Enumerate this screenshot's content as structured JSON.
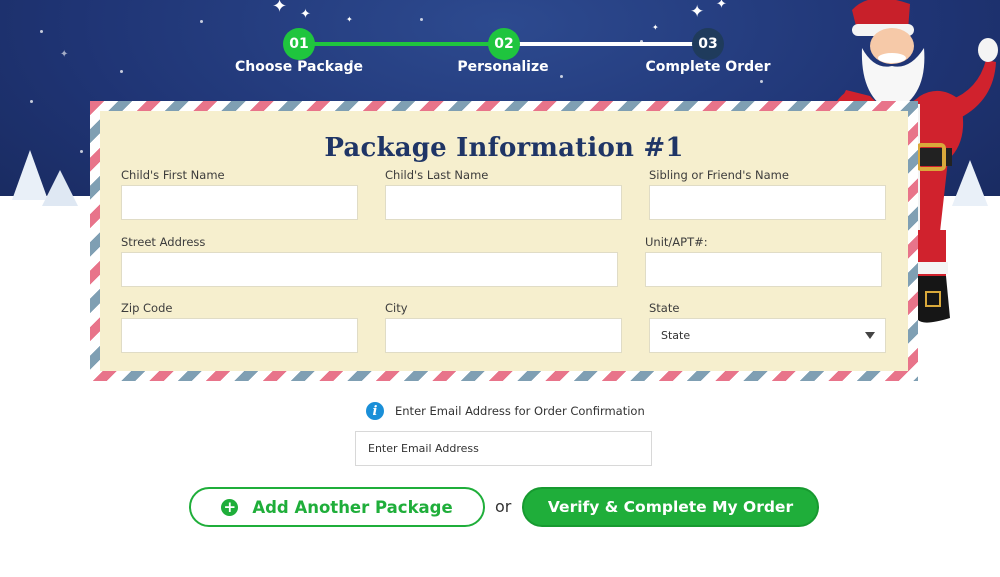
{
  "colors": {
    "hero_blue": "#1f3474",
    "step_done": "#1fc53e",
    "step_current": "#1f3b5c",
    "accent_green": "#1fae3a",
    "card_bg": "#f6efce",
    "title_navy": "#1f3566",
    "info_blue": "#1a8fd8"
  },
  "stepper": {
    "steps": [
      {
        "number": "01",
        "label": "Choose Package",
        "status": "complete"
      },
      {
        "number": "02",
        "label": "Personalize",
        "status": "complete"
      },
      {
        "number": "03",
        "label": "Complete Order",
        "status": "current"
      }
    ]
  },
  "package_form": {
    "title": "Package Information #1",
    "fields": {
      "first_name": {
        "label": "Child's First Name",
        "value": ""
      },
      "last_name": {
        "label": "Child's Last Name",
        "value": ""
      },
      "sibling_name": {
        "label": "Sibling or Friend's Name",
        "value": ""
      },
      "street": {
        "label": "Street Address",
        "value": ""
      },
      "unit": {
        "label": "Unit/APT#:",
        "value": ""
      },
      "zip": {
        "label": "Zip Code",
        "value": ""
      },
      "city": {
        "label": "City",
        "value": ""
      },
      "state": {
        "label": "State",
        "selected": "State"
      }
    }
  },
  "email_section": {
    "info_icon": "info-icon",
    "label": "Enter Email Address for Order Confirmation",
    "placeholder": "Enter Email Address"
  },
  "actions": {
    "add_package_label": "Add Another Package",
    "add_icon": "plus-circle-icon",
    "or_text": "or",
    "verify_label": "Verify & Complete My Order"
  }
}
